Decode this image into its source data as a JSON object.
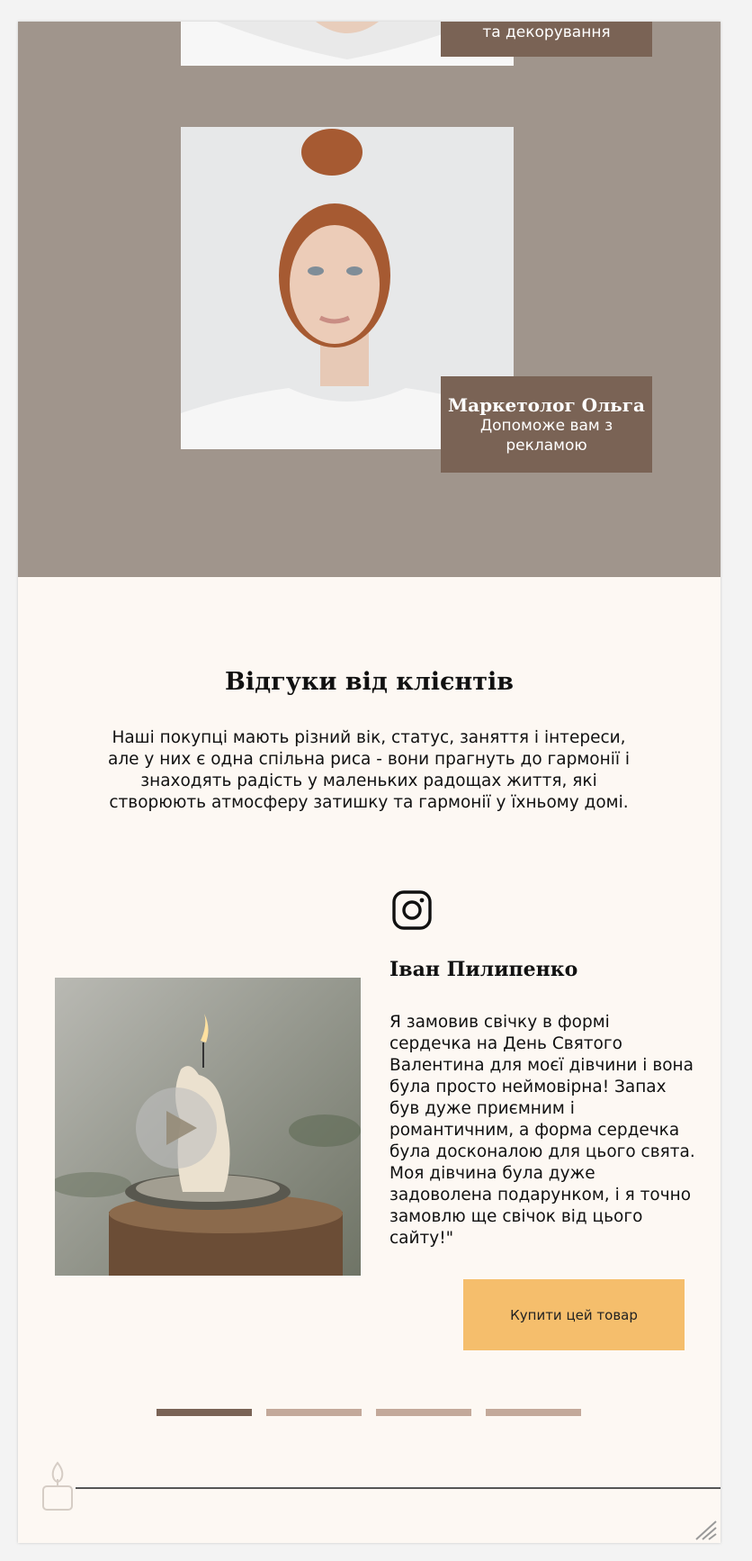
{
  "team": {
    "members": [
      {
        "name": "",
        "role": "та декорування"
      },
      {
        "name": "Маркетолог Ольга",
        "role": "Допоможе вам з рекламою"
      }
    ]
  },
  "reviews": {
    "title": "Відгуки від клієнтів",
    "intro": "Наші покупці мають різний вік, статус, заняття і інтереси, але у них є одна спільна риса - вони прагнуть до гармонії і знаходять радість у маленьких радощах життя, які створюють атмосферу затишку та гармонії у їхньому домі.",
    "social_icon": "instagram-icon",
    "reviewer_name": "Іван Пилипенко",
    "review_text": "Я замовив свічку в формі сердечка на День Святого Валентина для моєї дівчини і вона була просто неймовірна! Запах був дуже приємним і романтичним, а форма сердечка була досконалою для цього свята. Моя дівчина була дуже задоволена подарунком, і я точно замовлю ще свічок від цього сайту!\"",
    "buy_button": "Купити цей товар",
    "carousel": {
      "total": 4,
      "active": 1
    }
  },
  "colors": {
    "team_background": "#a0958c",
    "tag_background": "#7a6355",
    "page_background": "#fdf8f3",
    "buy_button": "#f5be6c",
    "dot_active": "#7a6355",
    "dot_inactive": "#c3a99a"
  }
}
